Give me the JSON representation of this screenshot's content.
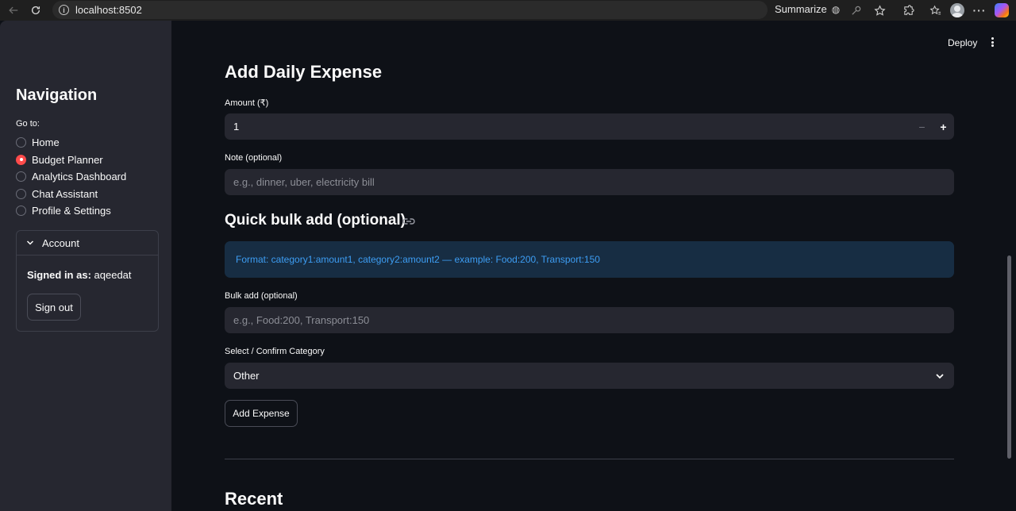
{
  "browser": {
    "url": "localhost:8502",
    "summarize_label": "Summarize"
  },
  "sidebar": {
    "title": "Navigation",
    "goto_label": "Go to:",
    "items": [
      {
        "label": "Home",
        "selected": false
      },
      {
        "label": "Budget Planner",
        "selected": true
      },
      {
        "label": "Analytics Dashboard",
        "selected": false
      },
      {
        "label": "Chat Assistant",
        "selected": false
      },
      {
        "label": "Profile & Settings",
        "selected": false
      }
    ],
    "account": {
      "header": "Account",
      "signed_in_prefix": "Signed in as:",
      "username": "aqeedat",
      "signout_label": "Sign out"
    }
  },
  "toolbar": {
    "deploy_label": "Deploy"
  },
  "main": {
    "section_title": "Add Daily Expense",
    "amount": {
      "label": "Amount (₹)",
      "value": "1"
    },
    "note": {
      "label": "Note (optional)",
      "placeholder": "e.g., dinner, uber, electricity bill"
    },
    "bulk_title": "Quick bulk add (optional)",
    "bulk_info": "Format: category1:amount1, category2:amount2 — example: Food:200, Transport:150",
    "bulk": {
      "label": "Bulk add (optional)",
      "placeholder": "e.g., Food:200, Transport:150"
    },
    "category": {
      "label": "Select / Confirm Category",
      "value": "Other"
    },
    "add_button_label": "Add Expense",
    "recent_title": "Recent"
  },
  "colors": {
    "accent": "#ff4b4b",
    "background": "#0e1117",
    "sidebar": "#262730",
    "info_text": "#3d9df3",
    "info_bg": "#172d43"
  }
}
